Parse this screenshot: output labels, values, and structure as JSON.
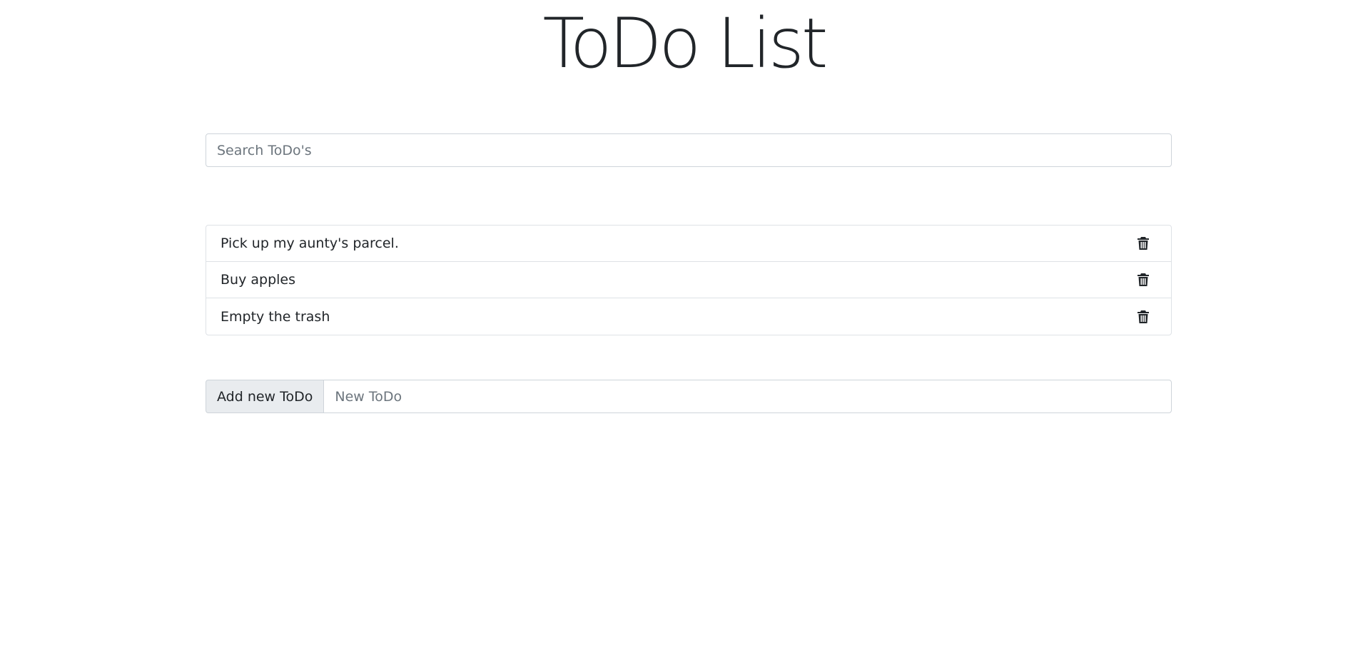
{
  "header": {
    "title": "ToDo List"
  },
  "search": {
    "placeholder": "Search ToDo's",
    "value": ""
  },
  "todos": [
    {
      "text": "Pick up my aunty's parcel.",
      "icon": "trash-icon"
    },
    {
      "text": "Buy apples",
      "icon": "trash-icon"
    },
    {
      "text": "Empty the trash",
      "icon": "trash-icon"
    }
  ],
  "add": {
    "label": "Add new ToDo",
    "placeholder": "New ToDo",
    "value": ""
  },
  "colors": {
    "text": "#212529",
    "border": "#dee2e6",
    "addon_bg": "#e9ecef",
    "placeholder": "#6c757d"
  }
}
